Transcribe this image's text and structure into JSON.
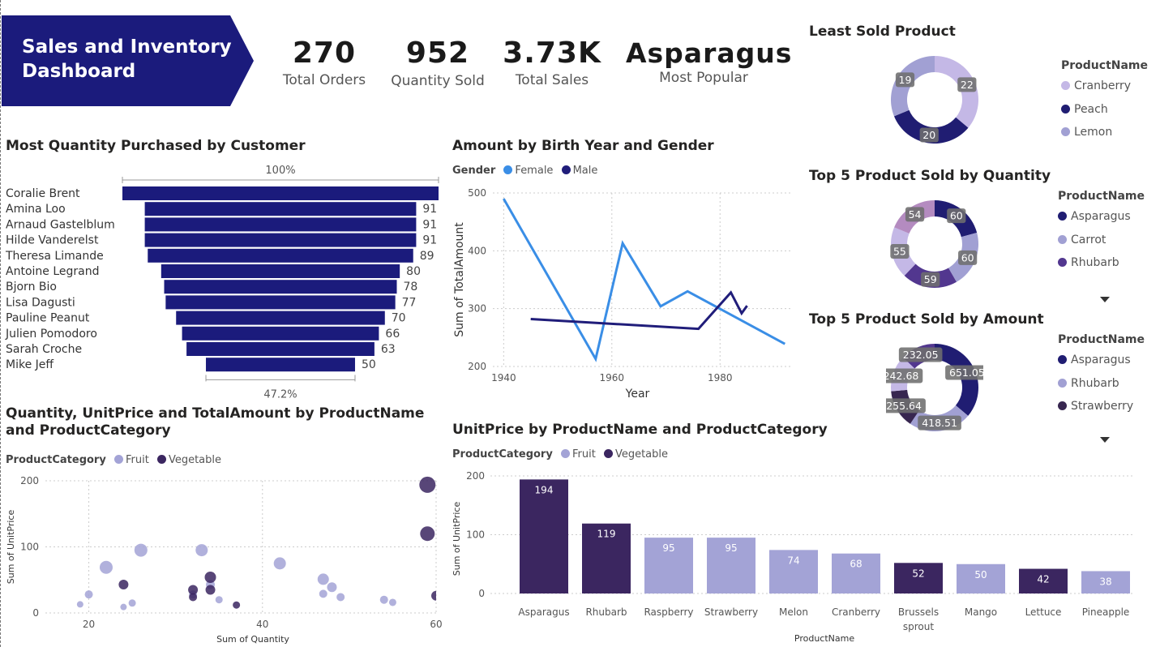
{
  "header": {
    "title": "Sales and Inventory Dashboard"
  },
  "kpis": [
    {
      "value": "270",
      "label": "Total Orders"
    },
    {
      "value": "952",
      "label": "Quantity Sold"
    },
    {
      "value": "3.73K",
      "label": "Total Sales"
    },
    {
      "value": "Asparagus",
      "label": "Most Popular"
    }
  ],
  "colors": {
    "navy": "#1b1b7c",
    "banner": "#1b1b7c",
    "female": "#3a8ee6",
    "male": "#201d7a",
    "fruit": "#a3a3d6",
    "vegetable": "#3b2660",
    "lavender": "#c4b8e6",
    "grid": "#d0d0d0"
  },
  "chart_data": [
    {
      "type": "bar",
      "id": "funnel",
      "title": "Most Quantity Purchased by Customer",
      "categories": [
        "Coralie Brent",
        "Amina Loo",
        "Arnaud Gastelblum",
        "Hilde Vanderelst",
        "Theresa Limande",
        "Antoine Legrand",
        "Bjorn Bio",
        "Lisa Dagusti",
        "Pauline Peanut",
        "Julien Pomodoro",
        "Sarah Croche",
        "Mike Jeff"
      ],
      "values": [
        106,
        91,
        91,
        91,
        89,
        80,
        78,
        77,
        70,
        66,
        63,
        50
      ],
      "data_labels": [
        "",
        "91",
        "91",
        "91",
        "89",
        "80",
        "78",
        "77",
        "70",
        "66",
        "63",
        "50"
      ],
      "top_label": "100%",
      "bottom_label": "47.2%",
      "color": "#1b1b7c"
    },
    {
      "type": "line",
      "id": "birthyear",
      "title": "Amount by Birth Year and Gender",
      "legend_title": "Gender",
      "xlabel": "Year",
      "ylabel": "Sum of TotalAmount",
      "xlim": [
        1938,
        1993
      ],
      "ylim": [
        200,
        500
      ],
      "xticks": [
        1940,
        1960,
        1980
      ],
      "yticks": [
        200,
        300,
        400,
        500
      ],
      "series": [
        {
          "name": "Female",
          "color": "#3a8ee6",
          "points": [
            [
              1940,
              490
            ],
            [
              1957,
              213
            ],
            [
              1962,
              413
            ],
            [
              1969,
              304
            ],
            [
              1974,
              330
            ],
            [
              1992,
              239
            ]
          ]
        },
        {
          "name": "Male",
          "color": "#201d7a",
          "points": [
            [
              1945,
              282
            ],
            [
              1976,
              265
            ],
            [
              1982,
              328
            ],
            [
              1984,
              292
            ],
            [
              1985,
              305
            ]
          ]
        }
      ]
    },
    {
      "type": "pie",
      "id": "least",
      "title": "Least Sold Product",
      "legend_title": "ProductName",
      "slices": [
        {
          "name": "Cranberry",
          "value": 22,
          "color": "#c4b8e6"
        },
        {
          "name": "Peach",
          "value": 20,
          "color": "#201d72"
        },
        {
          "name": "Lemon",
          "value": 19,
          "color": "#a1a0d3"
        }
      ]
    },
    {
      "type": "pie",
      "id": "topqty",
      "title": "Top 5 Product Sold by Quantity",
      "legend_title": "ProductName",
      "legend_visible": [
        "Asparagus",
        "Carrot",
        "Rhubarb"
      ],
      "slices": [
        {
          "name": "Asparagus",
          "value": 60,
          "color": "#201d72"
        },
        {
          "name": "Carrot",
          "value": 60,
          "color": "#a1a0d3"
        },
        {
          "name": "Rhubarb",
          "value": 59,
          "color": "#52378f"
        },
        {
          "name": "",
          "value": 55,
          "color": "#c4b8e6"
        },
        {
          "name": "",
          "value": 54,
          "color": "#b48bc0"
        }
      ]
    },
    {
      "type": "pie",
      "id": "topamt",
      "title": "Top 5 Product Sold by Amount",
      "legend_title": "ProductName",
      "legend_visible": [
        "Asparagus",
        "Rhubarb",
        "Strawberry"
      ],
      "slices": [
        {
          "name": "Asparagus",
          "value": 651.05,
          "color": "#201d72"
        },
        {
          "name": "Rhubarb",
          "value": 418.51,
          "color": "#a1a0d3"
        },
        {
          "name": "Strawberry",
          "value": 255.64,
          "color": "#372650"
        },
        {
          "name": "",
          "value": 242.68,
          "color": "#c4b8e6"
        },
        {
          "name": "",
          "value": 232.05,
          "color": "#52378f"
        }
      ]
    },
    {
      "type": "scatter",
      "id": "scatter",
      "title": "Quantity, UnitPrice and TotalAmount by ProductName and ProductCategory",
      "legend_title": "ProductCategory",
      "xlabel": "Sum of Quantity",
      "ylabel": "Sum of UnitPrice",
      "xlim": [
        15,
        60
      ],
      "ylim": [
        0,
        200
      ],
      "xticks": [
        20,
        40,
        60
      ],
      "yticks": [
        0,
        100,
        200
      ],
      "series": [
        {
          "name": "Fruit",
          "color": "#a3a3d6",
          "points": [
            [
              19,
              13,
              4
            ],
            [
              20,
              28,
              5
            ],
            [
              22,
              69,
              8
            ],
            [
              24,
              9,
              4
            ],
            [
              25,
              15,
              4.5
            ],
            [
              26,
              95,
              8
            ],
            [
              32,
              28,
              5
            ],
            [
              33,
              95,
              7.5
            ],
            [
              34,
              43,
              5.5
            ],
            [
              35,
              20,
              4.5
            ],
            [
              42,
              75,
              7.5
            ],
            [
              47,
              51,
              7
            ],
            [
              47,
              29,
              5
            ],
            [
              48,
              39,
              6
            ],
            [
              49,
              24,
              5
            ],
            [
              54,
              20,
              5
            ],
            [
              55,
              16,
              4.5
            ]
          ]
        },
        {
          "name": "Vegetable",
          "color": "#3b2660",
          "points": [
            [
              24,
              43,
              6
            ],
            [
              32,
              24,
              5
            ],
            [
              32,
              35,
              6
            ],
            [
              34,
              54,
              7
            ],
            [
              34,
              35,
              6
            ],
            [
              37,
              12,
              4.5
            ],
            [
              59,
              120,
              9
            ],
            [
              59,
              194,
              10
            ],
            [
              60,
              26,
              6
            ]
          ]
        }
      ]
    },
    {
      "type": "bar",
      "id": "unitprice",
      "title": "UnitPrice by ProductName and ProductCategory",
      "legend_title": "ProductCategory",
      "xlabel": "ProductName",
      "ylabel": "Sum of UnitPrice",
      "ylim": [
        0,
        200
      ],
      "yticks": [
        0,
        100,
        200
      ],
      "categories": [
        "Asparagus",
        "Rhubarb",
        "Raspberry",
        "Strawberry",
        "Melon",
        "Cranberry",
        "Brussels sprout",
        "Mango",
        "Lettuce",
        "Pineapple"
      ],
      "values": [
        194,
        119,
        95,
        95,
        74,
        68,
        52,
        50,
        42,
        38
      ],
      "groups": [
        "Vegetable",
        "Vegetable",
        "Fruit",
        "Fruit",
        "Fruit",
        "Fruit",
        "Vegetable",
        "Fruit",
        "Vegetable",
        "Fruit"
      ],
      "series": [
        {
          "name": "Fruit",
          "color": "#a3a3d6"
        },
        {
          "name": "Vegetable",
          "color": "#3b2660"
        }
      ]
    }
  ]
}
